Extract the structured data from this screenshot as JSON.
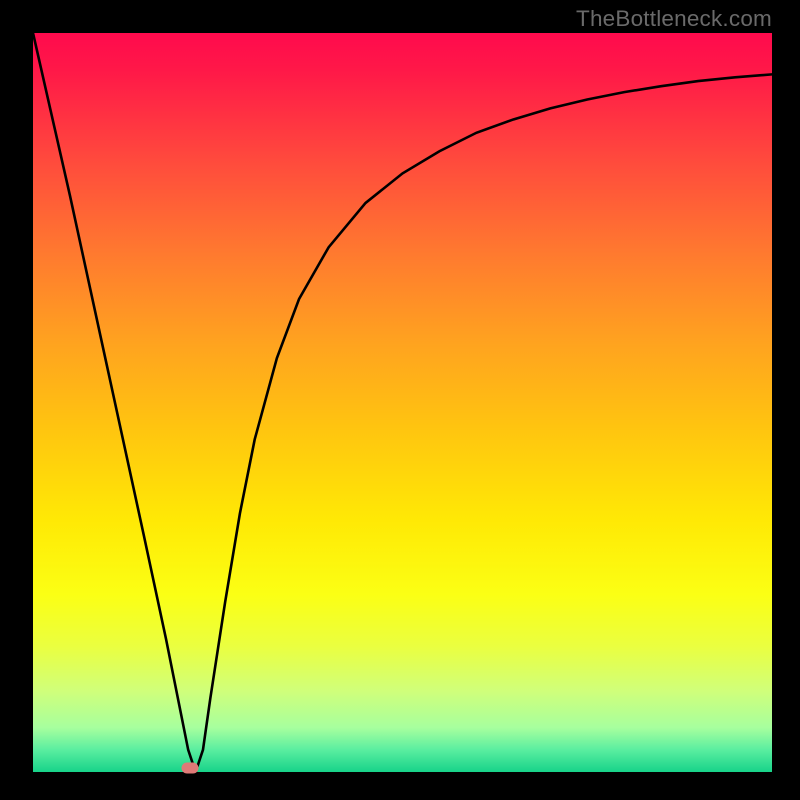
{
  "watermark": "TheBottleneck.com",
  "chart_data": {
    "type": "line",
    "title": "",
    "xlabel": "",
    "ylabel": "",
    "xlim": [
      0,
      100
    ],
    "ylim": [
      0,
      100
    ],
    "series": [
      {
        "name": "bottleneck-curve",
        "x": [
          0,
          5,
          10,
          15,
          18,
          20,
          21,
          22,
          23,
          24,
          26,
          28,
          30,
          33,
          36,
          40,
          45,
          50,
          55,
          60,
          65,
          70,
          75,
          80,
          85,
          90,
          95,
          100
        ],
        "values": [
          100,
          78,
          55,
          32,
          18,
          8,
          3,
          0,
          3,
          10,
          23,
          35,
          45,
          56,
          64,
          71,
          77,
          81,
          84,
          86.5,
          88.3,
          89.8,
          91,
          92,
          92.8,
          93.5,
          94,
          94.4
        ]
      }
    ],
    "annotations": [
      {
        "name": "min-marker",
        "x": 21.3,
        "y": 0
      }
    ],
    "background": {
      "type": "vertical-gradient",
      "top_color": "#ff0a4d",
      "bottom_color": "#17d38a",
      "meaning": "red=high bottleneck, green=low bottleneck"
    }
  }
}
